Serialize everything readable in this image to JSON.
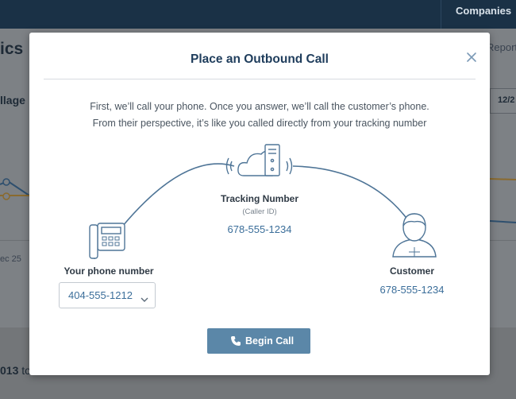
{
  "background": {
    "nav_item": "Companies",
    "page_title": "ics",
    "reports_link": "Report",
    "section_title": "llage",
    "date_chip": "12/2",
    "chart_tick": "ec 25",
    "bottom_bold": "013",
    "bottom_rest": " to"
  },
  "modal": {
    "title": "Place an Outbound Call",
    "close_icon": "close-icon",
    "description": "First, we’ll call your phone. Once you answer, we’ll call the customer’s phone. From their perspective, it’s like you called directly from your tracking number",
    "tracking": {
      "label": "Tracking Number",
      "sublabel": "(Caller ID)",
      "number": "678-555-1234",
      "icon": "cloud-server-icon"
    },
    "your_phone": {
      "label": "Your phone number",
      "selected": "404-555-1212",
      "icon": "desk-phone-icon"
    },
    "customer": {
      "label": "Customer",
      "number": "678-555-1234",
      "icon": "user-avatar-icon"
    },
    "begin_button": {
      "label": "Begin Call",
      "icon": "phone-icon"
    }
  },
  "colors": {
    "accent": "#5b87a8",
    "link": "#3b6e9a",
    "title": "#1f3d5c",
    "topbar": "#1a3146"
  }
}
